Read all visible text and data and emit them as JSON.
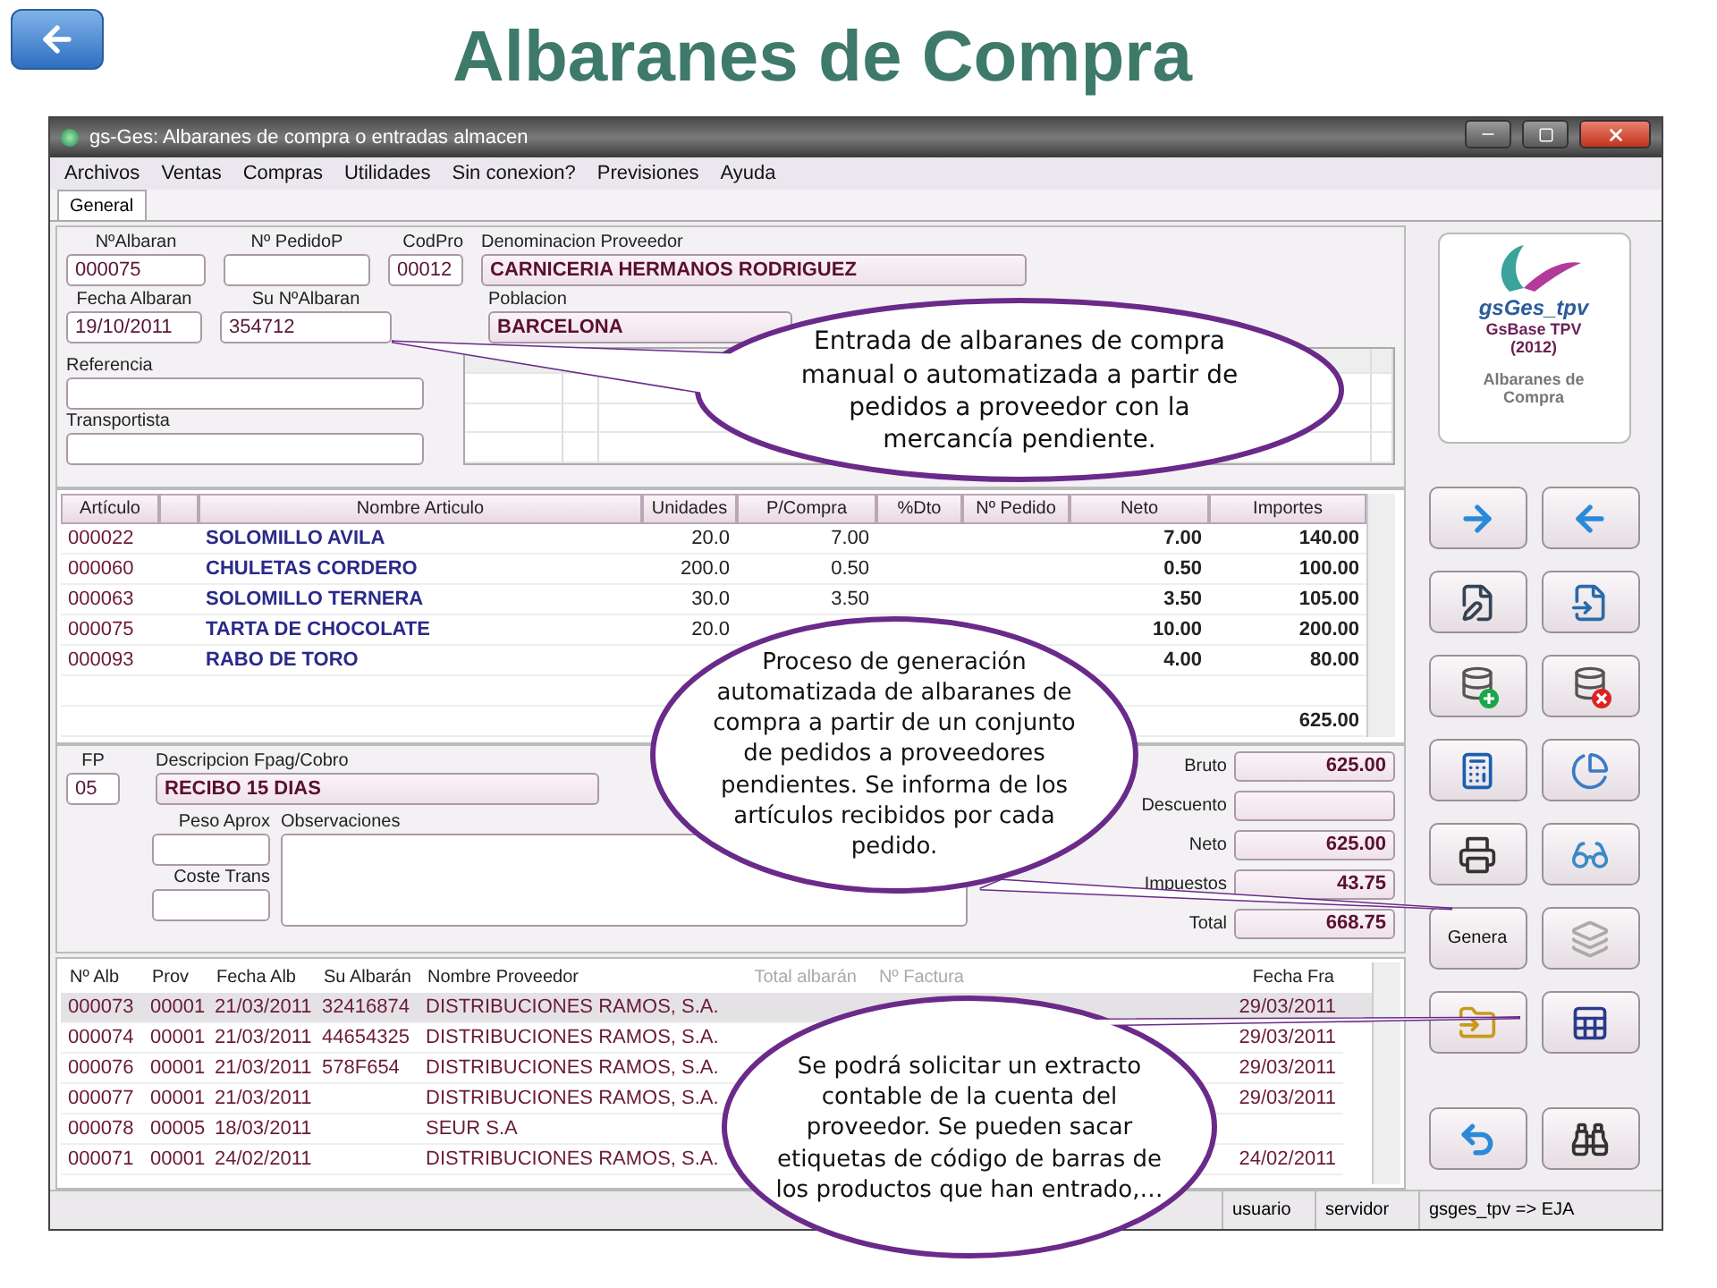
{
  "slide_title": "Albaranes de Compra",
  "window": {
    "title": "gs-Ges: Albaranes de compra o entradas almacen"
  },
  "menu": [
    "Archivos",
    "Ventas",
    "Compras",
    "Utilidades",
    "Sin conexion?",
    "Previsiones",
    "Ayuda"
  ],
  "tabs": [
    {
      "label": "General",
      "selected": true
    }
  ],
  "header": {
    "n_albaran": {
      "label": "NºAlbaran",
      "value": "000075"
    },
    "n_pedido": {
      "label": "Nº PedidoP"
    },
    "cod_pro": {
      "label": "CodPro",
      "value": "00012"
    },
    "proveedor": {
      "label": "Denominacion Proveedor",
      "value": "CARNICERIA HERMANOS RODRIGUEZ"
    },
    "fecha": {
      "label": "Fecha Albaran",
      "value": "19/10/2011"
    },
    "su_albaran": {
      "label": "Su NºAlbaran",
      "value": "354712"
    },
    "poblacion": {
      "label": "Poblacion",
      "value": "BARCELONA"
    },
    "referencia": {
      "label": "Referencia"
    },
    "transportista": {
      "label": "Transportista"
    }
  },
  "articles": {
    "columns": [
      "Artículo",
      "",
      "Nombre Articulo",
      "Unidades",
      "P/Compra",
      "%Dto",
      "Nº Pedido",
      "Neto",
      "Importes"
    ],
    "rows": [
      {
        "code": "000022",
        "name": "SOLOMILLO AVILA",
        "units": "20.0",
        "price": "7.00",
        "net": "7.00",
        "amount": "140.00"
      },
      {
        "code": "000060",
        "name": "CHULETAS CORDERO",
        "units": "200.0",
        "price": "0.50",
        "net": "0.50",
        "amount": "100.00"
      },
      {
        "code": "000063",
        "name": "SOLOMILLO TERNERA",
        "units": "30.0",
        "price": "3.50",
        "net": "3.50",
        "amount": "105.00"
      },
      {
        "code": "000075",
        "name": "TARTA DE CHOCOLATE",
        "units": "20.0",
        "net": "10.00",
        "amount": "200.00"
      },
      {
        "code": "000093",
        "name": "RABO DE TORO",
        "net": "4.00",
        "amount": "80.00"
      }
    ],
    "total_amount": "625.00"
  },
  "payment": {
    "fp": {
      "label": "FP",
      "value": "05"
    },
    "description": {
      "label": "Descripcion Fpag/Cobro",
      "value": "RECIBO 15 DIAS"
    },
    "weight": {
      "label": "Peso Aprox"
    },
    "transport": {
      "label": "Coste Trans"
    },
    "notes": {
      "label": "Observaciones"
    }
  },
  "totals": [
    {
      "label": "Bruto",
      "value": "625.00"
    },
    {
      "label": "Descuento"
    },
    {
      "label": "Neto",
      "value": "625.00"
    },
    {
      "label": "Impuestos",
      "value": "43.75"
    },
    {
      "label": "Total",
      "value": "668.75"
    }
  ],
  "history": {
    "columns": [
      "Nº Alb",
      "Prov",
      "Fecha Alb",
      "Su Albarán",
      "Nombre Proveedor",
      "Total albarán",
      "Nº Factura",
      "Fecha Fra"
    ],
    "rows": [
      {
        "selected": true,
        "cells": [
          "000073",
          "00001",
          "21/03/2011",
          "32416874",
          "DISTRIBUCIONES RAMOS, S.A.",
          "",
          "",
          "29/03/2011"
        ]
      },
      {
        "selected": false,
        "cells": [
          "000074",
          "00001",
          "21/03/2011",
          "44654325",
          "DISTRIBUCIONES RAMOS, S.A.",
          "",
          "",
          "29/03/2011"
        ]
      },
      {
        "selected": false,
        "cells": [
          "000076",
          "00001",
          "21/03/2011",
          "578F654",
          "DISTRIBUCIONES RAMOS, S.A.",
          "",
          "",
          "29/03/2011"
        ]
      },
      {
        "selected": false,
        "cells": [
          "000077",
          "00001",
          "21/03/2011",
          "",
          "DISTRIBUCIONES RAMOS, S.A.",
          "",
          "",
          "29/03/2011"
        ]
      },
      {
        "selected": false,
        "cells": [
          "000078",
          "00005",
          "18/03/2011",
          "",
          "SEUR S.A",
          "",
          "",
          ""
        ]
      },
      {
        "selected": false,
        "cells": [
          "000071",
          "00001",
          "24/02/2011",
          "",
          "DISTRIBUCIONES RAMOS, S.A.",
          "",
          "",
          "24/02/2011"
        ]
      }
    ]
  },
  "side_panel": {
    "logo": "gsGes_tpv",
    "product": "GsBase TPV",
    "year": "(2012)",
    "module": "Albaranes de Compra",
    "action_label": "Genera"
  },
  "status_bar": [
    "usuario",
    "servidor",
    "gsges_tpv => EJA"
  ],
  "callouts": [
    {
      "text": "Entrada de albaranes de compra manual o automatizada a partir de pedidos a proveedor con la mercancía pendiente."
    },
    {
      "text": "Proceso de generación automatizada de albaranes de compra a partir de un conjunto de pedidos a proveedores pendientes. Se informa de los artículos recibidos por cada pedido."
    },
    {
      "text": "Se podrá solicitar un extracto contable de la cuenta del proveedor. Se pueden sacar etiquetas de código de barras de los productos que han entrado,…"
    }
  ]
}
